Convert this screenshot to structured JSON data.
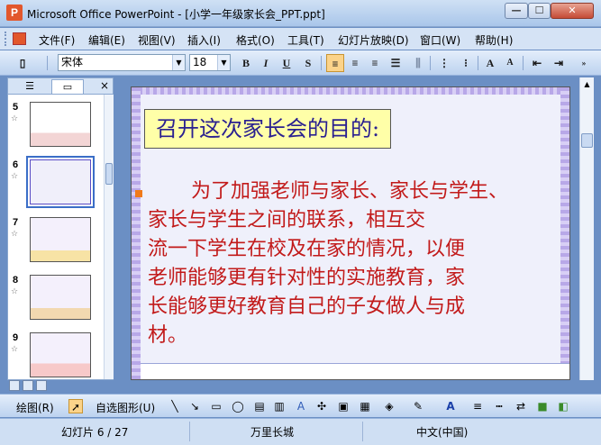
{
  "window": {
    "title": "Microsoft Office PowerPoint - [小学一年级家长会_PPT.ppt]",
    "app_icon": "P",
    "min_glyph": "—",
    "max_glyph": "☐",
    "close_glyph": "✕"
  },
  "menu": [
    "文件(F)",
    "编辑(E)",
    "视图(V)",
    "插入(I)",
    "格式(O)",
    "工具(T)",
    "幻灯片放映(D)",
    "窗口(W)",
    "帮助(H)"
  ],
  "toolbar": {
    "font_name": "宋体",
    "font_size": "18",
    "bold": "B",
    "italic": "I",
    "underline": "U",
    "shadow": "S",
    "grow_font": "A",
    "shrink_font": "A"
  },
  "left_pane": {
    "close": "×",
    "slides": [
      {
        "num": "5"
      },
      {
        "num": "6",
        "selected": true
      },
      {
        "num": "7"
      },
      {
        "num": "8"
      },
      {
        "num": "9"
      }
    ]
  },
  "slide": {
    "title": "召开这次家长会的目的:",
    "body": "为了加强老师与家长、家长与学生、家长与学生之间的联系，相互交流一下学生在校及在家的情况，以便老师能够更有针对性的实施教育，家长能够更好教育自己的子女做人与成材。",
    "lines": [
      "为了加强老师与家长、家长与学生、",
      "家长与学生之间的联系，相互交",
      "流一下学生在校及在家的情况，以便",
      "老师能够更有针对性的实施教育，家",
      "长能够更好教育自己的子女做人与成",
      "材。"
    ]
  },
  "draw_toolbar": {
    "draw_label": "绘图(R)",
    "autoshapes_label": "自选图形(U)"
  },
  "status": {
    "slide_pos": "幻灯片 6 / 27",
    "design": "万里长城",
    "language": "中文(中国)"
  },
  "colors": {
    "title_fg": "#2a2090",
    "body_fg": "#c21a1a",
    "title_bg": "#ffffa8"
  }
}
